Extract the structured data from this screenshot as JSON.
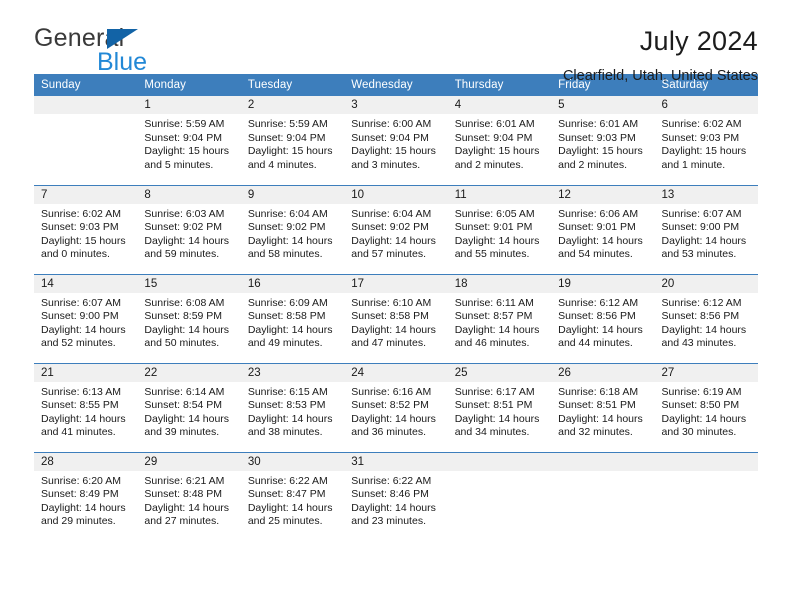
{
  "brand": {
    "name_part1": "General",
    "name_part2": "Blue",
    "triangle_icon": "blue-triangle-logo-icon",
    "color_dark": "#3a3a3a",
    "color_blue": "#2288d6",
    "color_triangle": "#1263a6"
  },
  "header": {
    "title": "July 2024",
    "subtitle": "Clearfield, Utah, United States"
  },
  "theme": {
    "header_row_bg": "#3d7ebc",
    "header_row_text": "#ffffff",
    "daynum_bg": "#f0f0f0",
    "cell_bg": "#ffffff",
    "grid_line": "#3d7ebc"
  },
  "weekday_headers": [
    "Sunday",
    "Monday",
    "Tuesday",
    "Wednesday",
    "Thursday",
    "Friday",
    "Saturday"
  ],
  "labels": {
    "sunrise_prefix": "Sunrise:",
    "sunset_prefix": "Sunset:",
    "daylight_prefix": "Daylight:"
  },
  "weeks": [
    [
      {
        "day": "",
        "sunrise": "",
        "sunset": "",
        "daylight_line1": "",
        "daylight_line2": ""
      },
      {
        "day": "1",
        "sunrise": "Sunrise: 5:59 AM",
        "sunset": "Sunset: 9:04 PM",
        "daylight_line1": "Daylight: 15 hours",
        "daylight_line2": "and 5 minutes."
      },
      {
        "day": "2",
        "sunrise": "Sunrise: 5:59 AM",
        "sunset": "Sunset: 9:04 PM",
        "daylight_line1": "Daylight: 15 hours",
        "daylight_line2": "and 4 minutes."
      },
      {
        "day": "3",
        "sunrise": "Sunrise: 6:00 AM",
        "sunset": "Sunset: 9:04 PM",
        "daylight_line1": "Daylight: 15 hours",
        "daylight_line2": "and 3 minutes."
      },
      {
        "day": "4",
        "sunrise": "Sunrise: 6:01 AM",
        "sunset": "Sunset: 9:04 PM",
        "daylight_line1": "Daylight: 15 hours",
        "daylight_line2": "and 2 minutes."
      },
      {
        "day": "5",
        "sunrise": "Sunrise: 6:01 AM",
        "sunset": "Sunset: 9:03 PM",
        "daylight_line1": "Daylight: 15 hours",
        "daylight_line2": "and 2 minutes."
      },
      {
        "day": "6",
        "sunrise": "Sunrise: 6:02 AM",
        "sunset": "Sunset: 9:03 PM",
        "daylight_line1": "Daylight: 15 hours",
        "daylight_line2": "and 1 minute."
      }
    ],
    [
      {
        "day": "7",
        "sunrise": "Sunrise: 6:02 AM",
        "sunset": "Sunset: 9:03 PM",
        "daylight_line1": "Daylight: 15 hours",
        "daylight_line2": "and 0 minutes."
      },
      {
        "day": "8",
        "sunrise": "Sunrise: 6:03 AM",
        "sunset": "Sunset: 9:02 PM",
        "daylight_line1": "Daylight: 14 hours",
        "daylight_line2": "and 59 minutes."
      },
      {
        "day": "9",
        "sunrise": "Sunrise: 6:04 AM",
        "sunset": "Sunset: 9:02 PM",
        "daylight_line1": "Daylight: 14 hours",
        "daylight_line2": "and 58 minutes."
      },
      {
        "day": "10",
        "sunrise": "Sunrise: 6:04 AM",
        "sunset": "Sunset: 9:02 PM",
        "daylight_line1": "Daylight: 14 hours",
        "daylight_line2": "and 57 minutes."
      },
      {
        "day": "11",
        "sunrise": "Sunrise: 6:05 AM",
        "sunset": "Sunset: 9:01 PM",
        "daylight_line1": "Daylight: 14 hours",
        "daylight_line2": "and 55 minutes."
      },
      {
        "day": "12",
        "sunrise": "Sunrise: 6:06 AM",
        "sunset": "Sunset: 9:01 PM",
        "daylight_line1": "Daylight: 14 hours",
        "daylight_line2": "and 54 minutes."
      },
      {
        "day": "13",
        "sunrise": "Sunrise: 6:07 AM",
        "sunset": "Sunset: 9:00 PM",
        "daylight_line1": "Daylight: 14 hours",
        "daylight_line2": "and 53 minutes."
      }
    ],
    [
      {
        "day": "14",
        "sunrise": "Sunrise: 6:07 AM",
        "sunset": "Sunset: 9:00 PM",
        "daylight_line1": "Daylight: 14 hours",
        "daylight_line2": "and 52 minutes."
      },
      {
        "day": "15",
        "sunrise": "Sunrise: 6:08 AM",
        "sunset": "Sunset: 8:59 PM",
        "daylight_line1": "Daylight: 14 hours",
        "daylight_line2": "and 50 minutes."
      },
      {
        "day": "16",
        "sunrise": "Sunrise: 6:09 AM",
        "sunset": "Sunset: 8:58 PM",
        "daylight_line1": "Daylight: 14 hours",
        "daylight_line2": "and 49 minutes."
      },
      {
        "day": "17",
        "sunrise": "Sunrise: 6:10 AM",
        "sunset": "Sunset: 8:58 PM",
        "daylight_line1": "Daylight: 14 hours",
        "daylight_line2": "and 47 minutes."
      },
      {
        "day": "18",
        "sunrise": "Sunrise: 6:11 AM",
        "sunset": "Sunset: 8:57 PM",
        "daylight_line1": "Daylight: 14 hours",
        "daylight_line2": "and 46 minutes."
      },
      {
        "day": "19",
        "sunrise": "Sunrise: 6:12 AM",
        "sunset": "Sunset: 8:56 PM",
        "daylight_line1": "Daylight: 14 hours",
        "daylight_line2": "and 44 minutes."
      },
      {
        "day": "20",
        "sunrise": "Sunrise: 6:12 AM",
        "sunset": "Sunset: 8:56 PM",
        "daylight_line1": "Daylight: 14 hours",
        "daylight_line2": "and 43 minutes."
      }
    ],
    [
      {
        "day": "21",
        "sunrise": "Sunrise: 6:13 AM",
        "sunset": "Sunset: 8:55 PM",
        "daylight_line1": "Daylight: 14 hours",
        "daylight_line2": "and 41 minutes."
      },
      {
        "day": "22",
        "sunrise": "Sunrise: 6:14 AM",
        "sunset": "Sunset: 8:54 PM",
        "daylight_line1": "Daylight: 14 hours",
        "daylight_line2": "and 39 minutes."
      },
      {
        "day": "23",
        "sunrise": "Sunrise: 6:15 AM",
        "sunset": "Sunset: 8:53 PM",
        "daylight_line1": "Daylight: 14 hours",
        "daylight_line2": "and 38 minutes."
      },
      {
        "day": "24",
        "sunrise": "Sunrise: 6:16 AM",
        "sunset": "Sunset: 8:52 PM",
        "daylight_line1": "Daylight: 14 hours",
        "daylight_line2": "and 36 minutes."
      },
      {
        "day": "25",
        "sunrise": "Sunrise: 6:17 AM",
        "sunset": "Sunset: 8:51 PM",
        "daylight_line1": "Daylight: 14 hours",
        "daylight_line2": "and 34 minutes."
      },
      {
        "day": "26",
        "sunrise": "Sunrise: 6:18 AM",
        "sunset": "Sunset: 8:51 PM",
        "daylight_line1": "Daylight: 14 hours",
        "daylight_line2": "and 32 minutes."
      },
      {
        "day": "27",
        "sunrise": "Sunrise: 6:19 AM",
        "sunset": "Sunset: 8:50 PM",
        "daylight_line1": "Daylight: 14 hours",
        "daylight_line2": "and 30 minutes."
      }
    ],
    [
      {
        "day": "28",
        "sunrise": "Sunrise: 6:20 AM",
        "sunset": "Sunset: 8:49 PM",
        "daylight_line1": "Daylight: 14 hours",
        "daylight_line2": "and 29 minutes."
      },
      {
        "day": "29",
        "sunrise": "Sunrise: 6:21 AM",
        "sunset": "Sunset: 8:48 PM",
        "daylight_line1": "Daylight: 14 hours",
        "daylight_line2": "and 27 minutes."
      },
      {
        "day": "30",
        "sunrise": "Sunrise: 6:22 AM",
        "sunset": "Sunset: 8:47 PM",
        "daylight_line1": "Daylight: 14 hours",
        "daylight_line2": "and 25 minutes."
      },
      {
        "day": "31",
        "sunrise": "Sunrise: 6:22 AM",
        "sunset": "Sunset: 8:46 PM",
        "daylight_line1": "Daylight: 14 hours",
        "daylight_line2": "and 23 minutes."
      },
      {
        "day": "",
        "sunrise": "",
        "sunset": "",
        "daylight_line1": "",
        "daylight_line2": ""
      },
      {
        "day": "",
        "sunrise": "",
        "sunset": "",
        "daylight_line1": "",
        "daylight_line2": ""
      },
      {
        "day": "",
        "sunrise": "",
        "sunset": "",
        "daylight_line1": "",
        "daylight_line2": ""
      }
    ]
  ]
}
